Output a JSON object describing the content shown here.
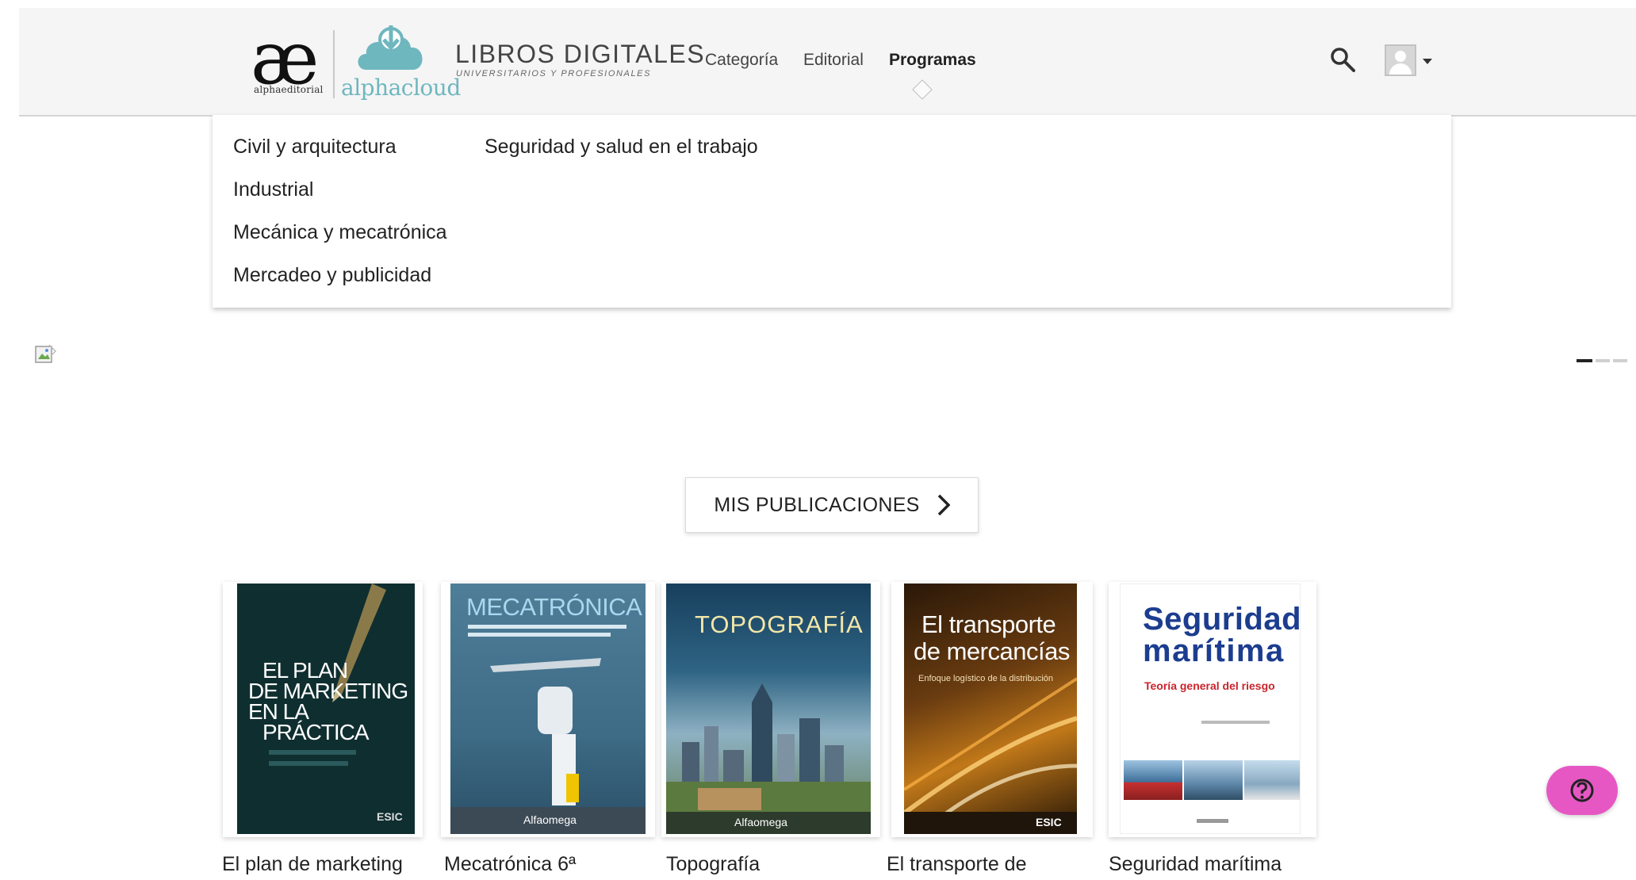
{
  "header": {
    "logo_glyph": "æ",
    "logo_sub": "alphaeditorial",
    "cloud_word": "alphacloud",
    "brand_title": "LIBROS DIGITALES",
    "brand_sub": "UNIVERSITARIOS Y PROFESIONALES",
    "nav": [
      {
        "label": "Categoría"
      },
      {
        "label": "Editorial"
      },
      {
        "label": "Programas",
        "active": true
      }
    ]
  },
  "menu": {
    "col1": [
      "Civil y arquitectura",
      "Industrial",
      "Mecánica y mecatrónica",
      "Mercadeo y publicidad"
    ],
    "col2": [
      "Seguridad y salud en el trabajo"
    ]
  },
  "publications_button": "MIS PUBLICACIONES",
  "books": [
    {
      "title": "El plan de marketing",
      "cover": {
        "line1": "EL PLAN",
        "line2": "DE MARKETING",
        "line3": "EN LA",
        "line4": "PRÁCTICA",
        "publisher": "ESIC"
      }
    },
    {
      "title": "Mecatrónica 6ª",
      "cover": {
        "line1": "MECATRÓNICA",
        "publisher": "Alfaomega"
      }
    },
    {
      "title": "Topografía",
      "cover": {
        "line1": "TOPOGRAFÍA",
        "publisher": "Alfaomega"
      }
    },
    {
      "title": "El transporte de",
      "cover": {
        "line1": "El transporte",
        "line2": "de mercancías",
        "line3": "Enfoque logístico de la distribución",
        "publisher": "ESIC"
      }
    },
    {
      "title": "Seguridad marítima",
      "cover": {
        "line1": "Seguridad",
        "line2": "marítima",
        "line3": "Teoría general del riesgo"
      }
    }
  ],
  "colors": {
    "accent_teal": "#6fb7bf",
    "help_pink": "#e657c4",
    "header_bg": "#f5f5f5"
  },
  "icons": [
    "search-icon",
    "avatar",
    "chevron-right-icon",
    "help-icon",
    "broken-image-icon"
  ]
}
